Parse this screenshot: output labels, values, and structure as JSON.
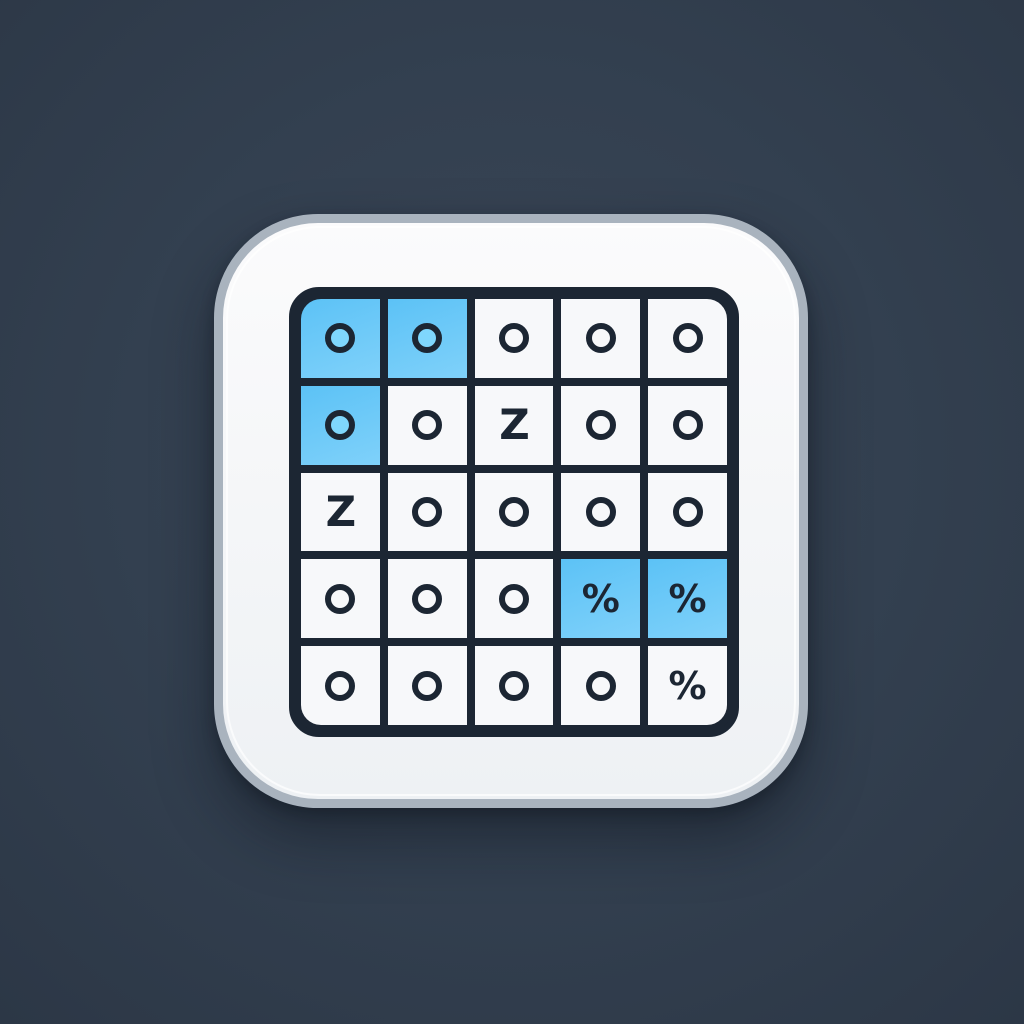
{
  "grid": {
    "rows": [
      [
        {
          "char": "O",
          "highlighted": true
        },
        {
          "char": "O",
          "highlighted": true
        },
        {
          "char": "O",
          "highlighted": false
        },
        {
          "char": "O",
          "highlighted": false
        },
        {
          "char": "O",
          "highlighted": false
        }
      ],
      [
        {
          "char": "O",
          "highlighted": true
        },
        {
          "char": "O",
          "highlighted": false
        },
        {
          "char": "Z",
          "highlighted": false
        },
        {
          "char": "O",
          "highlighted": false
        },
        {
          "char": "O",
          "highlighted": false
        }
      ],
      [
        {
          "char": "Z",
          "highlighted": false
        },
        {
          "char": "O",
          "highlighted": false
        },
        {
          "char": "O",
          "highlighted": false
        },
        {
          "char": "O",
          "highlighted": false
        },
        {
          "char": "O",
          "highlighted": false
        }
      ],
      [
        {
          "char": "O",
          "highlighted": false
        },
        {
          "char": "O",
          "highlighted": false
        },
        {
          "char": "O",
          "highlighted": false
        },
        {
          "char": "%",
          "highlighted": true
        },
        {
          "char": "%",
          "highlighted": true
        }
      ],
      [
        {
          "char": "O",
          "highlighted": false
        },
        {
          "char": "O",
          "highlighted": false
        },
        {
          "char": "O",
          "highlighted": false
        },
        {
          "char": "O",
          "highlighted": false
        },
        {
          "char": "%",
          "highlighted": false
        }
      ]
    ]
  },
  "colors": {
    "background": "#334050",
    "icon_face": "#f7f8fa",
    "icon_rim": "#a9b3be",
    "ink": "#1c2633",
    "highlight": "#6ccaf8"
  },
  "icons": {
    "app": "word-grid-icon"
  }
}
